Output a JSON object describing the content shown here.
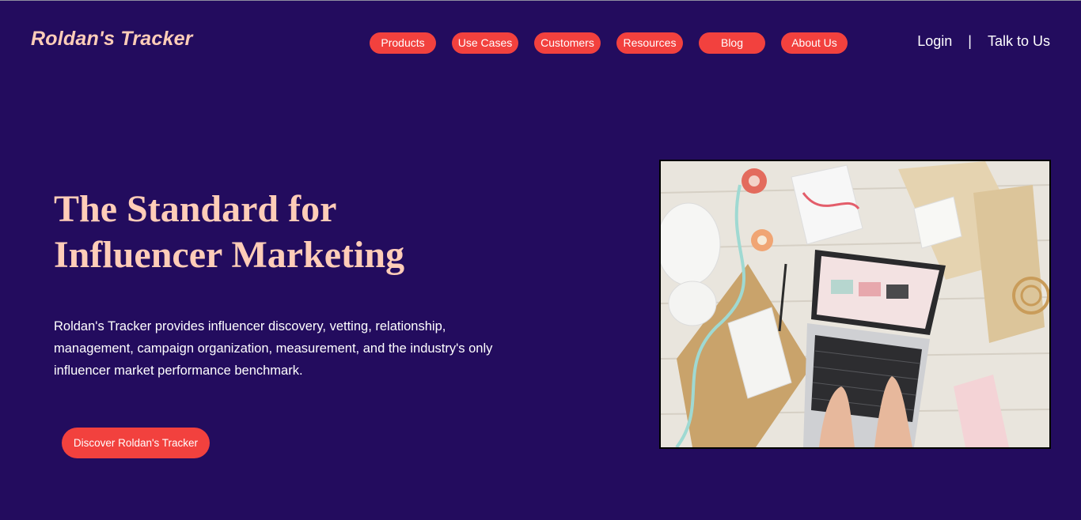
{
  "brand": {
    "name": "Roldan's Tracker"
  },
  "nav": {
    "items": [
      {
        "label": "Products"
      },
      {
        "label": "Use Cases"
      },
      {
        "label": "Customers"
      },
      {
        "label": "Resources"
      },
      {
        "label": "Blog"
      },
      {
        "label": "About Us"
      }
    ]
  },
  "auth": {
    "login_label": "Login",
    "separator": "|",
    "talk_label": "Talk to Us"
  },
  "hero": {
    "title_line1": "The Standard for",
    "title_line2": "Influencer Marketing",
    "description": "Roldan's Tracker provides influencer discovery, vetting, relationship, management, campaign organization, measurement, and the industry's only influencer market performance benchmark.",
    "cta_label": "Discover Roldan's Tracker",
    "image_desc": "desk-with-laptop-photo"
  },
  "colors": {
    "background": "#230c5e",
    "accent": "#f2413e",
    "heading": "#ffcdb8",
    "text": "#ffffff"
  }
}
